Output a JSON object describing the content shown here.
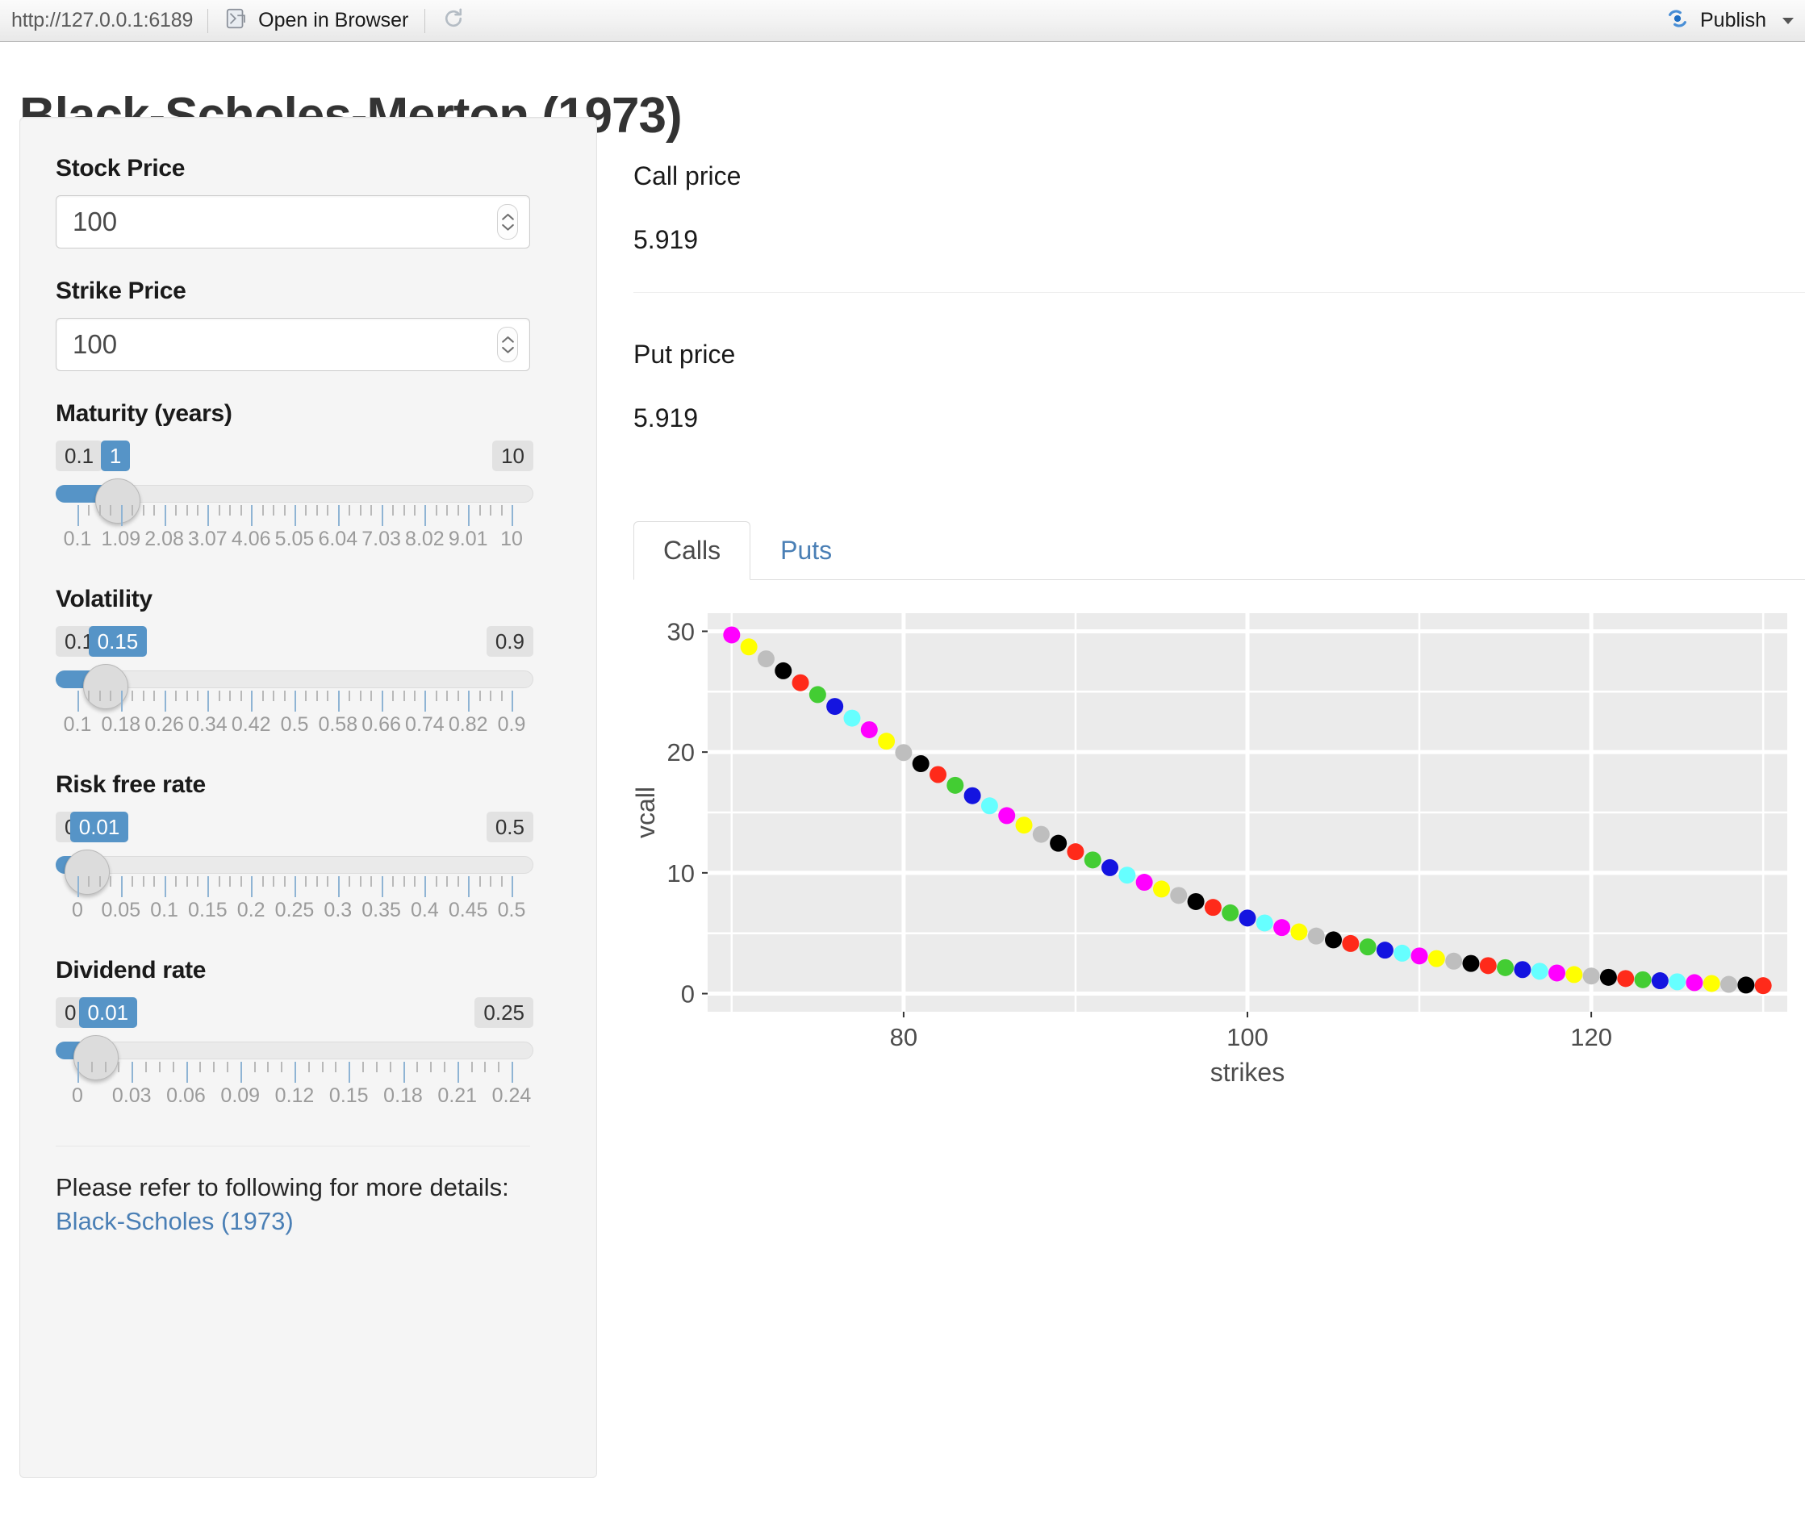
{
  "toolbar": {
    "url": "http://127.0.0.1:6189",
    "open_in_browser": "Open in Browser",
    "refresh_icon": "refresh-icon",
    "browser_icon": "external-window-icon",
    "publish_label": "Publish",
    "publish_icon": "publish-icon",
    "caret_icon": "caret-down-icon"
  },
  "page": {
    "title": "Black-Scholes-Merton (1973)"
  },
  "sidebar": {
    "stock_price": {
      "label": "Stock Price",
      "value": "100"
    },
    "strike_price": {
      "label": "Strike Price",
      "value": "100"
    },
    "maturity": {
      "label": "Maturity (years)",
      "value": "1",
      "min": "0.1",
      "max": "10",
      "tick_labels": [
        "0.1",
        "1.09",
        "2.08",
        "3.07",
        "4.06",
        "5.05",
        "6.04",
        "7.03",
        "8.02",
        "9.01",
        "10"
      ]
    },
    "volatility": {
      "label": "Volatility",
      "value": "0.15",
      "min": "0.1",
      "max": "0.9",
      "tick_labels": [
        "0.1",
        "0.18",
        "0.26",
        "0.34",
        "0.42",
        "0.5",
        "0.58",
        "0.66",
        "0.74",
        "0.82",
        "0.9"
      ]
    },
    "risk_free_rate": {
      "label": "Risk free rate",
      "value": "0.01",
      "min": "0",
      "max": "0.5",
      "tick_labels": [
        "0",
        "0.05",
        "0.1",
        "0.15",
        "0.2",
        "0.25",
        "0.3",
        "0.35",
        "0.4",
        "0.45",
        "0.5"
      ]
    },
    "dividend_rate": {
      "label": "Dividend rate",
      "value": "0.01",
      "min": "0",
      "max": "0.25",
      "tick_labels": [
        "0",
        "0.03",
        "0.06",
        "0.09",
        "0.12",
        "0.15",
        "0.18",
        "0.21",
        "0.24"
      ]
    },
    "help_prefix": "Please refer to following for more details: ",
    "help_link": "Black-Scholes (1973)"
  },
  "main": {
    "call_label": "Call price",
    "call_value": "5.919",
    "put_label": "Put price",
    "put_value": "5.919",
    "tabs": [
      {
        "label": "Calls",
        "active": true
      },
      {
        "label": "Puts",
        "active": false
      }
    ]
  },
  "chart_data": {
    "type": "scatter",
    "title": "",
    "xlabel": "strikes",
    "ylabel": "vcall",
    "xlim": [
      68.6,
      131.4
    ],
    "ylim": [
      -1.5,
      31.5
    ],
    "xticks": [
      80,
      100,
      120
    ],
    "yticks": [
      0,
      10,
      20,
      30
    ],
    "grid": true,
    "legend": "none",
    "panel_bg": "#ebebeb",
    "grid_color": "#ffffff",
    "point_colors": [
      "#ff00ff",
      "#ffff00",
      "#bebebe",
      "#000000",
      "#ff2a1a",
      "#43cd33",
      "#1414e0",
      "#66ffff"
    ],
    "x": [
      70,
      71,
      72,
      73,
      74,
      75,
      76,
      77,
      78,
      79,
      80,
      81,
      82,
      83,
      84,
      85,
      86,
      87,
      88,
      89,
      90,
      91,
      92,
      93,
      94,
      95,
      96,
      97,
      98,
      99,
      100,
      101,
      102,
      103,
      104,
      105,
      106,
      107,
      108,
      109,
      110,
      111,
      112,
      113,
      114,
      115,
      116,
      117,
      118,
      119,
      120,
      121,
      122,
      123,
      124,
      125,
      126,
      127,
      128,
      129,
      130
    ],
    "y": [
      29.7,
      28.71,
      27.72,
      26.73,
      25.74,
      24.76,
      23.78,
      22.81,
      21.85,
      20.9,
      19.96,
      19.04,
      18.14,
      17.25,
      16.39,
      15.55,
      14.74,
      13.95,
      13.19,
      12.45,
      11.75,
      11.07,
      10.43,
      9.81,
      9.22,
      8.66,
      8.13,
      7.62,
      7.14,
      6.69,
      6.26,
      5.85,
      5.47,
      5.11,
      4.77,
      4.45,
      4.15,
      3.87,
      3.6,
      3.35,
      3.12,
      2.9,
      2.69,
      2.5,
      2.32,
      2.15,
      1.99,
      1.85,
      1.71,
      1.58,
      1.46,
      1.35,
      1.25,
      1.15,
      1.07,
      0.98,
      0.91,
      0.84,
      0.77,
      0.71,
      0.66
    ]
  }
}
